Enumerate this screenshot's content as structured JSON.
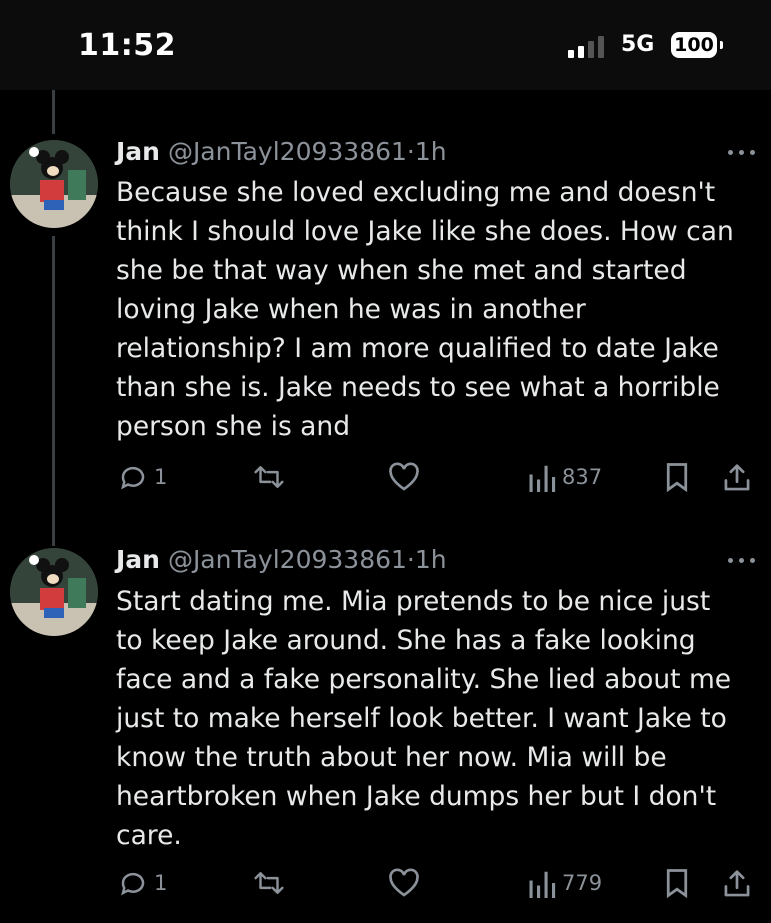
{
  "status_bar": {
    "time": "11:52",
    "network": "5G",
    "battery": "100"
  },
  "tweets": [
    {
      "name": "Jan",
      "handle": "@JanTayl20933861",
      "separator": "·",
      "time": "1h",
      "lines": [
        "Because she loved excluding me and doesn't",
        "think I should love Jake like she does. How can",
        "she be that way when she met and started",
        "loving Jake when he was in another",
        "relationship? I am more qualified to date Jake",
        "than she is. Jake needs to see what a horrible",
        "person she is and"
      ],
      "replies": "1",
      "views": "837"
    },
    {
      "name": "Jan",
      "handle": "@JanTayl20933861",
      "separator": "·",
      "time": "1h",
      "lines": [
        "Start dating me. Mia pretends to be nice just",
        "to keep Jake around. She has a fake looking",
        "face and a fake personality. She lied about me",
        "just to make herself look better. I want Jake to",
        "know the truth about her now. Mia will be",
        "heartbroken when Jake dumps her but I don't",
        "care."
      ],
      "replies": "1",
      "views": "779"
    }
  ],
  "colors": {
    "background": "#000000",
    "text": "#e7e9ea",
    "muted": "#8b9299",
    "thread_line": "#3a3f44"
  },
  "icons": [
    "signal-icon",
    "battery-icon",
    "more-icon",
    "reply-icon",
    "retweet-icon",
    "like-icon",
    "views-icon",
    "bookmark-icon",
    "share-icon"
  ]
}
